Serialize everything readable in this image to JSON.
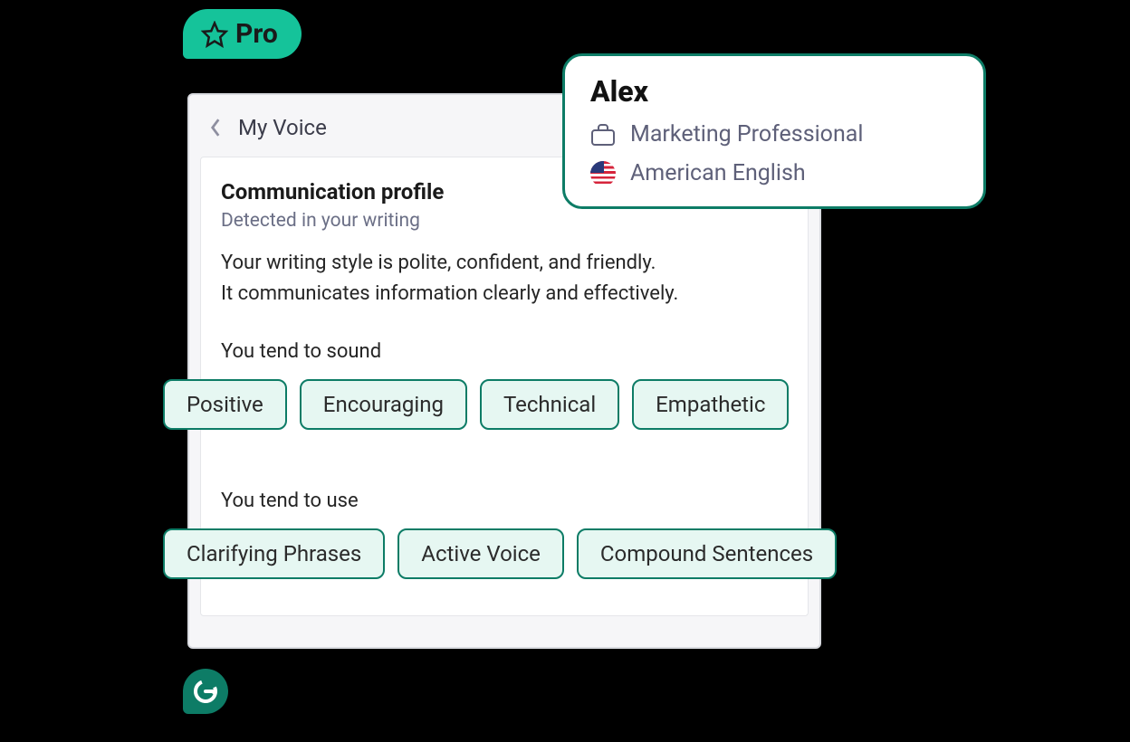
{
  "pro": {
    "label": "Pro"
  },
  "panel": {
    "title": "My Voice",
    "card_title": "Communication profile",
    "subtitle": "Detected in your writing",
    "description_line1": "Your writing style is polite, confident, and friendly.",
    "description_line2": "It communicates information clearly and effectively.",
    "sound_label": "You tend to sound",
    "use_label": "You tend to use"
  },
  "tone_pills": {
    "0": "Positive",
    "1": "Encouraging",
    "2": "Technical",
    "3": "Empathetic"
  },
  "style_pills": {
    "0": "Clarifying Phrases",
    "1": "Active Voice",
    "2": "Compound Sentences"
  },
  "user": {
    "name": "Alex",
    "role": "Marketing Professional",
    "language": "American English"
  }
}
